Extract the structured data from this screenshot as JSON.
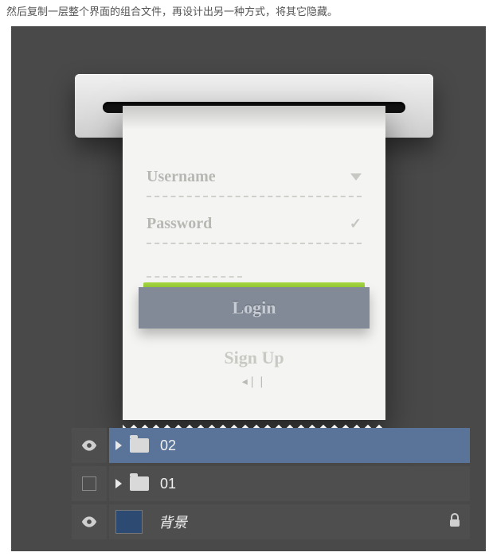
{
  "caption": "然后复制一层整个界面的组合文件，再设计出另一种方式，将其它隐藏。",
  "form": {
    "username_label": "Username",
    "password_label": "Password",
    "login_label": "Login",
    "signup_label": "Sign Up"
  },
  "layers": {
    "items": [
      {
        "name": "02",
        "visible": true,
        "type": "folder",
        "selected": true
      },
      {
        "name": "01",
        "visible": false,
        "type": "folder",
        "selected": false
      },
      {
        "name": "背景",
        "visible": true,
        "type": "layer",
        "selected": false,
        "locked": true,
        "thumb_color": "#2d4a73"
      }
    ]
  }
}
